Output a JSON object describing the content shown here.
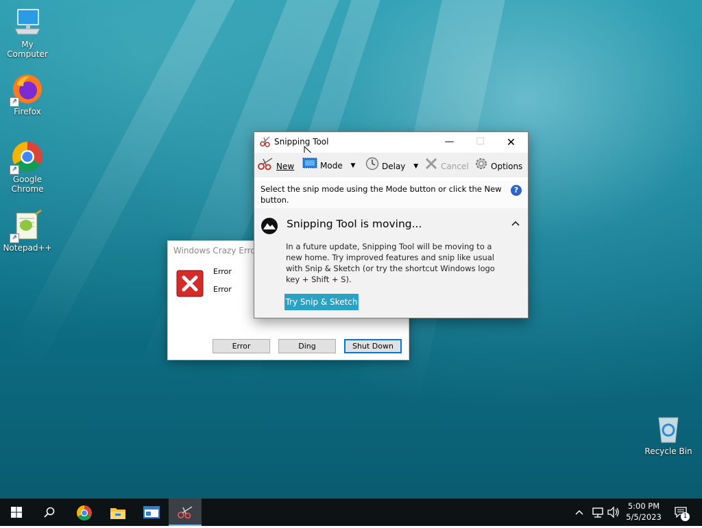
{
  "desktop": {
    "icons": [
      {
        "label": "My Computer"
      },
      {
        "label": "Firefox"
      },
      {
        "label": "Google Chrome"
      },
      {
        "label": "Notepad++"
      },
      {
        "label": "Recycle Bin"
      }
    ]
  },
  "error_dialog": {
    "title": "Windows Crazy Error",
    "lines": [
      "Error",
      "Error"
    ],
    "buttons": [
      "Error",
      "Ding",
      "Shut Down"
    ],
    "icon": "error-x-icon"
  },
  "snipping_tool": {
    "title": "Snipping Tool",
    "toolbar": {
      "new_label": "New",
      "mode_label": "Mode",
      "delay_label": "Delay",
      "cancel_label": "Cancel",
      "options_label": "Options"
    },
    "info_text": "Select the snip mode using the Mode button or click the New button.",
    "panel": {
      "title": "Snipping Tool is moving...",
      "body": "In a future update, Snipping Tool will be moving to a new home. Try improved features and snip like usual with Snip & Sketch (or try the shortcut Windows logo key + Shift + S).",
      "button_label": "Try Snip & Sketch"
    }
  },
  "taskbar": {
    "time": "5:00 PM",
    "date": "5/5/2023",
    "notification_count": "1"
  },
  "colors": {
    "accent": "#29a3c3",
    "taskbar": "#0d1215",
    "error_red": "#d42a2a"
  }
}
